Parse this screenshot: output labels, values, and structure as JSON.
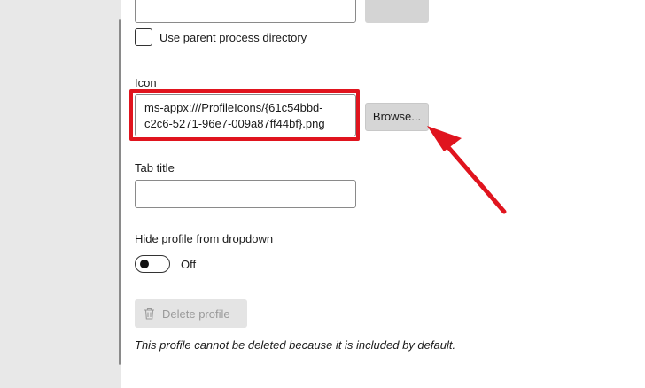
{
  "settings": {
    "checkbox_label": "Use parent process directory",
    "checkbox_checked": false,
    "icon_label": "Icon",
    "icon_value": "ms-appx:///ProfileIcons/{61c54bbd-c2c6-5271-96e7-009a87ff44bf}.png",
    "icon_value_line1": "ms-appx:///ProfileIcons/{61c54bbd-",
    "icon_value_line2": "c2c6-5271-96e7-009a87ff44bf}.png",
    "browse_label": "Browse...",
    "tab_title_label": "Tab title",
    "tab_title_value": "",
    "hide_label": "Hide profile from dropdown",
    "toggle_state": "Off",
    "delete_label": "Delete profile",
    "delete_note": "This profile cannot be deleted because it is included by default."
  },
  "annotation": {
    "highlight_color": "#e0141e",
    "arrow_color": "#e0141e"
  },
  "icons": {
    "trash": "trash-icon",
    "arrow": "arrow-icon"
  }
}
